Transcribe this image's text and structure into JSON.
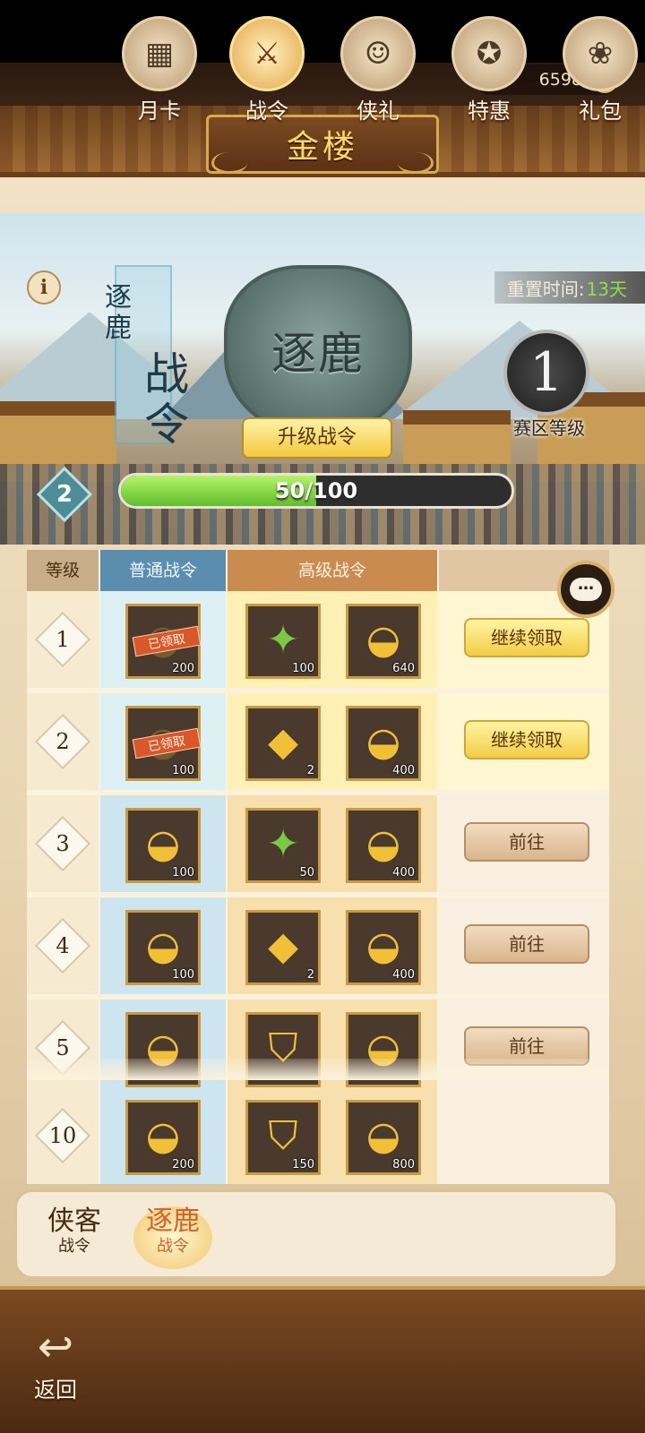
{
  "header": {
    "currency_value": "6598",
    "plus_symbol": "+",
    "title": "金楼"
  },
  "banner": {
    "info_symbol": "i",
    "reset_label": "重置时间:",
    "reset_value": "13天",
    "pass_title_small": "逐鹿",
    "pass_title_big": "战令",
    "emblem_text": "逐鹿",
    "upgrade_button": "升级战令",
    "zone_level": "1",
    "zone_label": "赛区等级",
    "player_level": "2",
    "progress_text": "50/100",
    "progress_fraction": 0.5
  },
  "table": {
    "headers": {
      "level": "等级",
      "normal": "普通战令",
      "premium": "高级战令"
    },
    "rows": [
      {
        "level": "1",
        "normal": {
          "qty": "200",
          "stamp": "已领取"
        },
        "premium": [
          {
            "qty": "100"
          },
          {
            "qty": "640"
          }
        ],
        "action": "继续领取"
      },
      {
        "level": "2",
        "normal": {
          "qty": "100",
          "stamp": "已领取"
        },
        "premium": [
          {
            "qty": "2"
          },
          {
            "qty": "400"
          }
        ],
        "action": "继续领取"
      },
      {
        "level": "3",
        "normal": {
          "qty": "100"
        },
        "premium": [
          {
            "qty": "50"
          },
          {
            "qty": "400"
          }
        ],
        "action": "前往"
      },
      {
        "level": "4",
        "normal": {
          "qty": "100"
        },
        "premium": [
          {
            "qty": "2"
          },
          {
            "qty": "400"
          }
        ],
        "action": "前往"
      },
      {
        "level": "5",
        "normal": {
          "qty": ""
        },
        "premium": [
          {
            "qty": ""
          },
          {
            "qty": ""
          }
        ],
        "action": "前往"
      },
      {
        "level": "10",
        "normal": {
          "qty": "200"
        },
        "premium": [
          {
            "qty": "150"
          },
          {
            "qty": "800"
          }
        ],
        "action": ""
      }
    ]
  },
  "tabs": {
    "xiake": {
      "line1": "侠客",
      "line2": "战令"
    },
    "zhuolu": {
      "line1": "逐鹿",
      "line2": "战令"
    }
  },
  "nav": {
    "back": "返回",
    "items": [
      "月卡",
      "战令",
      "侠礼",
      "特惠",
      "礼包"
    ]
  },
  "icons": {
    "gold": "gold-ingot-icon",
    "item_gold_glyph": "◒",
    "item_jade_glyph": "✦",
    "item_pack_glyph": "◆",
    "item_shield_glyph": "⛉",
    "chat_glyph": "…",
    "back_arrow": "↩"
  },
  "colors": {
    "accent_green": "#8fe04a",
    "title_gold": "#ffd86a",
    "stamp_red": "#d9572b"
  }
}
